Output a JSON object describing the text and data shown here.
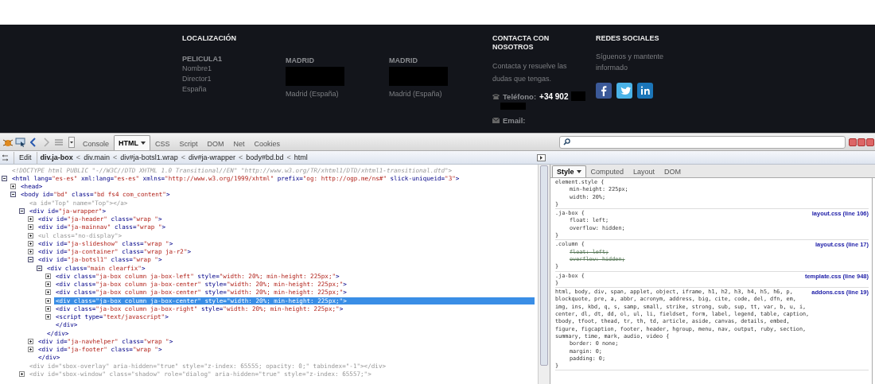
{
  "footer": {
    "columns": [
      {
        "kind": "info",
        "heading": "LOCALIZACIÓN",
        "title": "PELICULA1",
        "lines": [
          "Nombre1",
          "Director1",
          "España"
        ]
      },
      {
        "kind": "address",
        "title": "MADRID",
        "redacted": true,
        "lines": [
          "Madrid (España)"
        ]
      },
      {
        "kind": "address",
        "title": "MADRID",
        "redacted": true,
        "lines": [
          "Madrid (España)"
        ]
      },
      {
        "kind": "contact",
        "heading": "CONTACTA CON NOSOTROS",
        "text": "Contacta y resuelve las dudas que tengas.",
        "phone_label": "Teléfono:",
        "phone": "+34 902",
        "redacted": true,
        "email_label": "Email:"
      },
      {
        "kind": "social",
        "heading": "REDES SOCIALES",
        "text": "Síguenos y mantente informado",
        "networks": [
          {
            "kind": "facebook"
          },
          {
            "kind": "twitter"
          },
          {
            "kind": "linkedin"
          }
        ]
      }
    ]
  },
  "toolbar": {
    "tabs": [
      {
        "label": "Console",
        "selected": false,
        "menu": false
      },
      {
        "label": "HTML",
        "selected": true,
        "menu": true
      },
      {
        "label": "CSS",
        "selected": false,
        "menu": false
      },
      {
        "label": "Script",
        "selected": false,
        "menu": false
      },
      {
        "label": "DOM",
        "selected": false,
        "menu": false
      },
      {
        "label": "Net",
        "selected": false,
        "menu": false
      },
      {
        "label": "Cookies",
        "selected": false,
        "menu": false
      }
    ],
    "search": {
      "icon": true
    }
  },
  "breadcrumb": {
    "edit": "Edit",
    "crumbs": [
      {
        "label": "div.ja-box",
        "selected": true,
        "separator": "<"
      },
      {
        "label": "div.main",
        "selected": false,
        "separator": "<"
      },
      {
        "label": "div#ja-botsl1.wrap",
        "selected": false,
        "separator": "<"
      },
      {
        "label": "div#ja-wrapper",
        "selected": false,
        "separator": "<"
      },
      {
        "label": "body#bd.bd",
        "selected": false,
        "separator": "<"
      },
      {
        "label": "html",
        "selected": false
      }
    ]
  },
  "html_tree": [
    {
      "kind": "doctype",
      "text": "<!DOCTYPE html PUBLIC \"-//W3C//DTD XHTML 1.0 Transitional//EN\" \"http://www.w3.org/TR/xhtml1/DTD/xhtml1-transitional.dtd\">"
    },
    {
      "kind": "element",
      "text": "<html lang=\"es-es\" xml:lang=\"es-es\" xmlns=\"http://www.w3.org/1999/xhtml\" prefix=\"og: http://ogp.me/ns#\" slick-uniqueid=\"3\">",
      "expanded": true,
      "children": [
        {
          "kind": "element",
          "text": "<head>",
          "expanded": false
        },
        {
          "kind": "element",
          "text": "<body id=\"bd\" class=\"bd fs4 com_content\">",
          "expanded": true,
          "children": [
            {
              "kind": "dimmed",
              "text": "<a id=\"Top\" name=\"Top\"></a>"
            },
            {
              "kind": "element",
              "text": "<div id=\"ja-wrapper\">",
              "expanded": true,
              "children": [
                {
                  "kind": "element",
                  "text": "<div id=\"ja-header\" class=\"wrap \">",
                  "expanded": false
                },
                {
                  "kind": "element",
                  "text": "<div id=\"ja-mainnav\" class=\"wrap \">",
                  "expanded": false
                },
                {
                  "kind": "dimmed",
                  "text": "<ul class=\"no-display\">",
                  "expanded": false
                },
                {
                  "kind": "element",
                  "text": "<div id=\"ja-slideshow\" class=\"wrap \">",
                  "expanded": false
                },
                {
                  "kind": "element",
                  "text": "<div id=\"ja-container\" class=\"wrap ja-r2\">",
                  "expanded": false
                },
                {
                  "kind": "element",
                  "text": "<div id=\"ja-botsl1\" class=\"wrap \">",
                  "expanded": true,
                  "children": [
                    {
                      "kind": "element",
                      "text": "<div class=\"main clearfix\">",
                      "expanded": true,
                      "children": [
                        {
                          "kind": "element",
                          "text": "<div class=\"ja-box column ja-box-left\" style=\"width: 20%; min-height: 225px;\">",
                          "expanded": false,
                          "selected": false
                        },
                        {
                          "kind": "element",
                          "text": "<div class=\"ja-box column ja-box-center\" style=\"width: 20%; min-height: 225px;\">",
                          "expanded": false,
                          "selected": false
                        },
                        {
                          "kind": "element",
                          "text": "<div class=\"ja-box column ja-box-center\" style=\"width: 20%; min-height: 225px;\">",
                          "expanded": false,
                          "selected": false
                        },
                        {
                          "kind": "element",
                          "text": "<div class=\"ja-box column ja-box-center\" style=\"width: 20%; min-height: 225px;\">",
                          "expanded": false,
                          "selected": true
                        },
                        {
                          "kind": "element",
                          "text": "<div class=\"ja-box column ja-box-right\" style=\"width: 20%; min-height: 225px;\">",
                          "expanded": false,
                          "selected": false
                        },
                        {
                          "kind": "element",
                          "text": "<script type=\"text/javascript\">",
                          "expanded": false,
                          "selected": false
                        },
                        {
                          "kind": "element",
                          "text": "</div>"
                        }
                      ]
                    },
                    {
                      "kind": "element",
                      "text": "</div>"
                    }
                  ]
                },
                {
                  "kind": "element",
                  "text": "<div id=\"ja-navhelper\" class=\"wrap \">",
                  "expanded": false
                },
                {
                  "kind": "element",
                  "text": "<div id=\"ja-footer\" class=\"wrap \">",
                  "expanded": false
                },
                {
                  "kind": "element",
                  "text": "</div>"
                }
              ]
            },
            {
              "kind": "dimmed",
              "text": "<div id=\"sbox-overlay\" aria-hidden=\"true\" style=\"z-index: 65555; opacity: 0;\" tabindex=\"-1\"></div>"
            },
            {
              "kind": "dimmed",
              "text": "<div id=\"sbox-window\" class=\"shadow\" role=\"dialog\" aria-hidden=\"true\" style=\"z-index: 65557;\">",
              "expanded": false
            }
          ]
        }
      ]
    }
  ],
  "side_panel": {
    "tabs": [
      {
        "label": "Style",
        "selected": true,
        "menu": true
      },
      {
        "label": "Computed",
        "selected": false,
        "menu": false
      },
      {
        "label": "Layout",
        "selected": false,
        "menu": false
      },
      {
        "label": "DOM",
        "selected": false,
        "menu": false
      }
    ],
    "rules": [
      {
        "selector": "element.style {",
        "declarations": [
          {
            "text": "min-height: 225px;",
            "overridden": false
          },
          {
            "text": "width: 20%;",
            "overridden": false
          }
        ],
        "close": "}"
      },
      {
        "selector": ".ja-box {",
        "source": "layout.css (line 106)",
        "declarations": [
          {
            "text": "float: left;",
            "overridden": false
          },
          {
            "text": "overflow: hidden;",
            "overridden": false
          }
        ],
        "close": "}"
      },
      {
        "selector": ".column {",
        "source": "layout.css (line 17)",
        "declarations": [
          {
            "text": "float: left;",
            "overridden": true
          },
          {
            "text": "overflow: hidden;",
            "overridden": true
          }
        ],
        "close": "}"
      },
      {
        "selector": ".ja-box {",
        "source": "template.css (line 948)",
        "close": "}"
      },
      {
        "selector": "html, body, div, span, applet, object, iframe, h1, h2, h3, h4, h5, h6, p, blockquote, pre, a, abbr, acronym, address, big, cite, code, del, dfn, em, img, ins, kbd, q, s, samp, small, strike, strong, sub, sup, tt, var, b, u, i, center, dl, dt, dd, ol, ul, li, fieldset, form, label, legend, table, caption, tbody, tfoot, thead, tr, th, td, article, aside, canvas, details, embed, figure, figcaption, footer, header, hgroup, menu, nav, output, ruby, section, summary, time, mark, audio, video {",
        "source": "addons.css (line 19)",
        "declarations": [
          {
            "text": "border: 0 none;",
            "overridden": false
          },
          {
            "text": "margin: 0;",
            "overridden": false
          },
          {
            "text": "padding: 0;",
            "overridden": false
          }
        ],
        "close": "}"
      }
    ]
  }
}
